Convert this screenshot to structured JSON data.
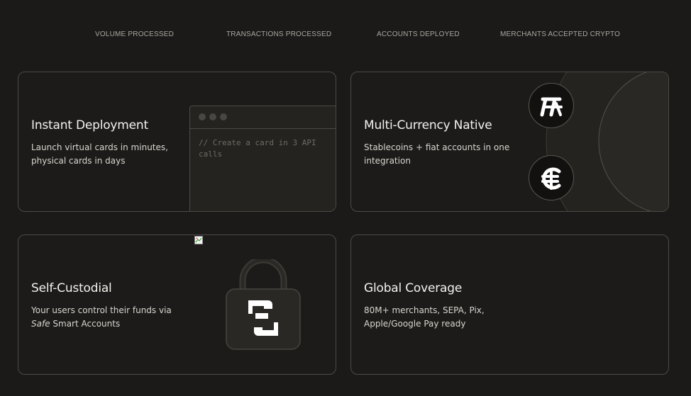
{
  "stats": [
    {
      "label": "VOLUME PROCESSED"
    },
    {
      "label": "TRANSACTIONS PROCESSED"
    },
    {
      "label": "ACCOUNTS DEPLOYED"
    },
    {
      "label": "MERCHANTS ACCEPTED CRYPTO"
    }
  ],
  "cards": {
    "instant": {
      "title": "Instant Deployment",
      "desc_line1": "Launch virtual cards in minutes,",
      "desc_line2": "physical cards in days",
      "code": "// Create a card in 3 API calls"
    },
    "multi": {
      "title": "Multi-Currency Native",
      "desc_line1": "Stablecoins + fiat accounts in one",
      "desc_line2": "integration",
      "icons": [
        "usdt-coin-icon",
        "euro-coin-icon"
      ]
    },
    "custodial": {
      "title": "Self-Custodial",
      "desc_line1": "Your users control their funds via",
      "desc_italic": "Safe",
      "desc_line2_rest": " Smart Accounts",
      "icons": [
        "broken-image-icon",
        "lock-icon",
        "safe-logo-icon"
      ]
    },
    "global": {
      "title": "Global Coverage",
      "desc_line1": "80M+ merchants, SEPA, Pix,",
      "desc_line2": "Apple/Google Pay ready"
    }
  },
  "colors": {
    "background": "#1b1a18",
    "card_border": "#4d4a45",
    "text_primary": "#f4f2ee",
    "text_muted": "#a9a6a0"
  }
}
